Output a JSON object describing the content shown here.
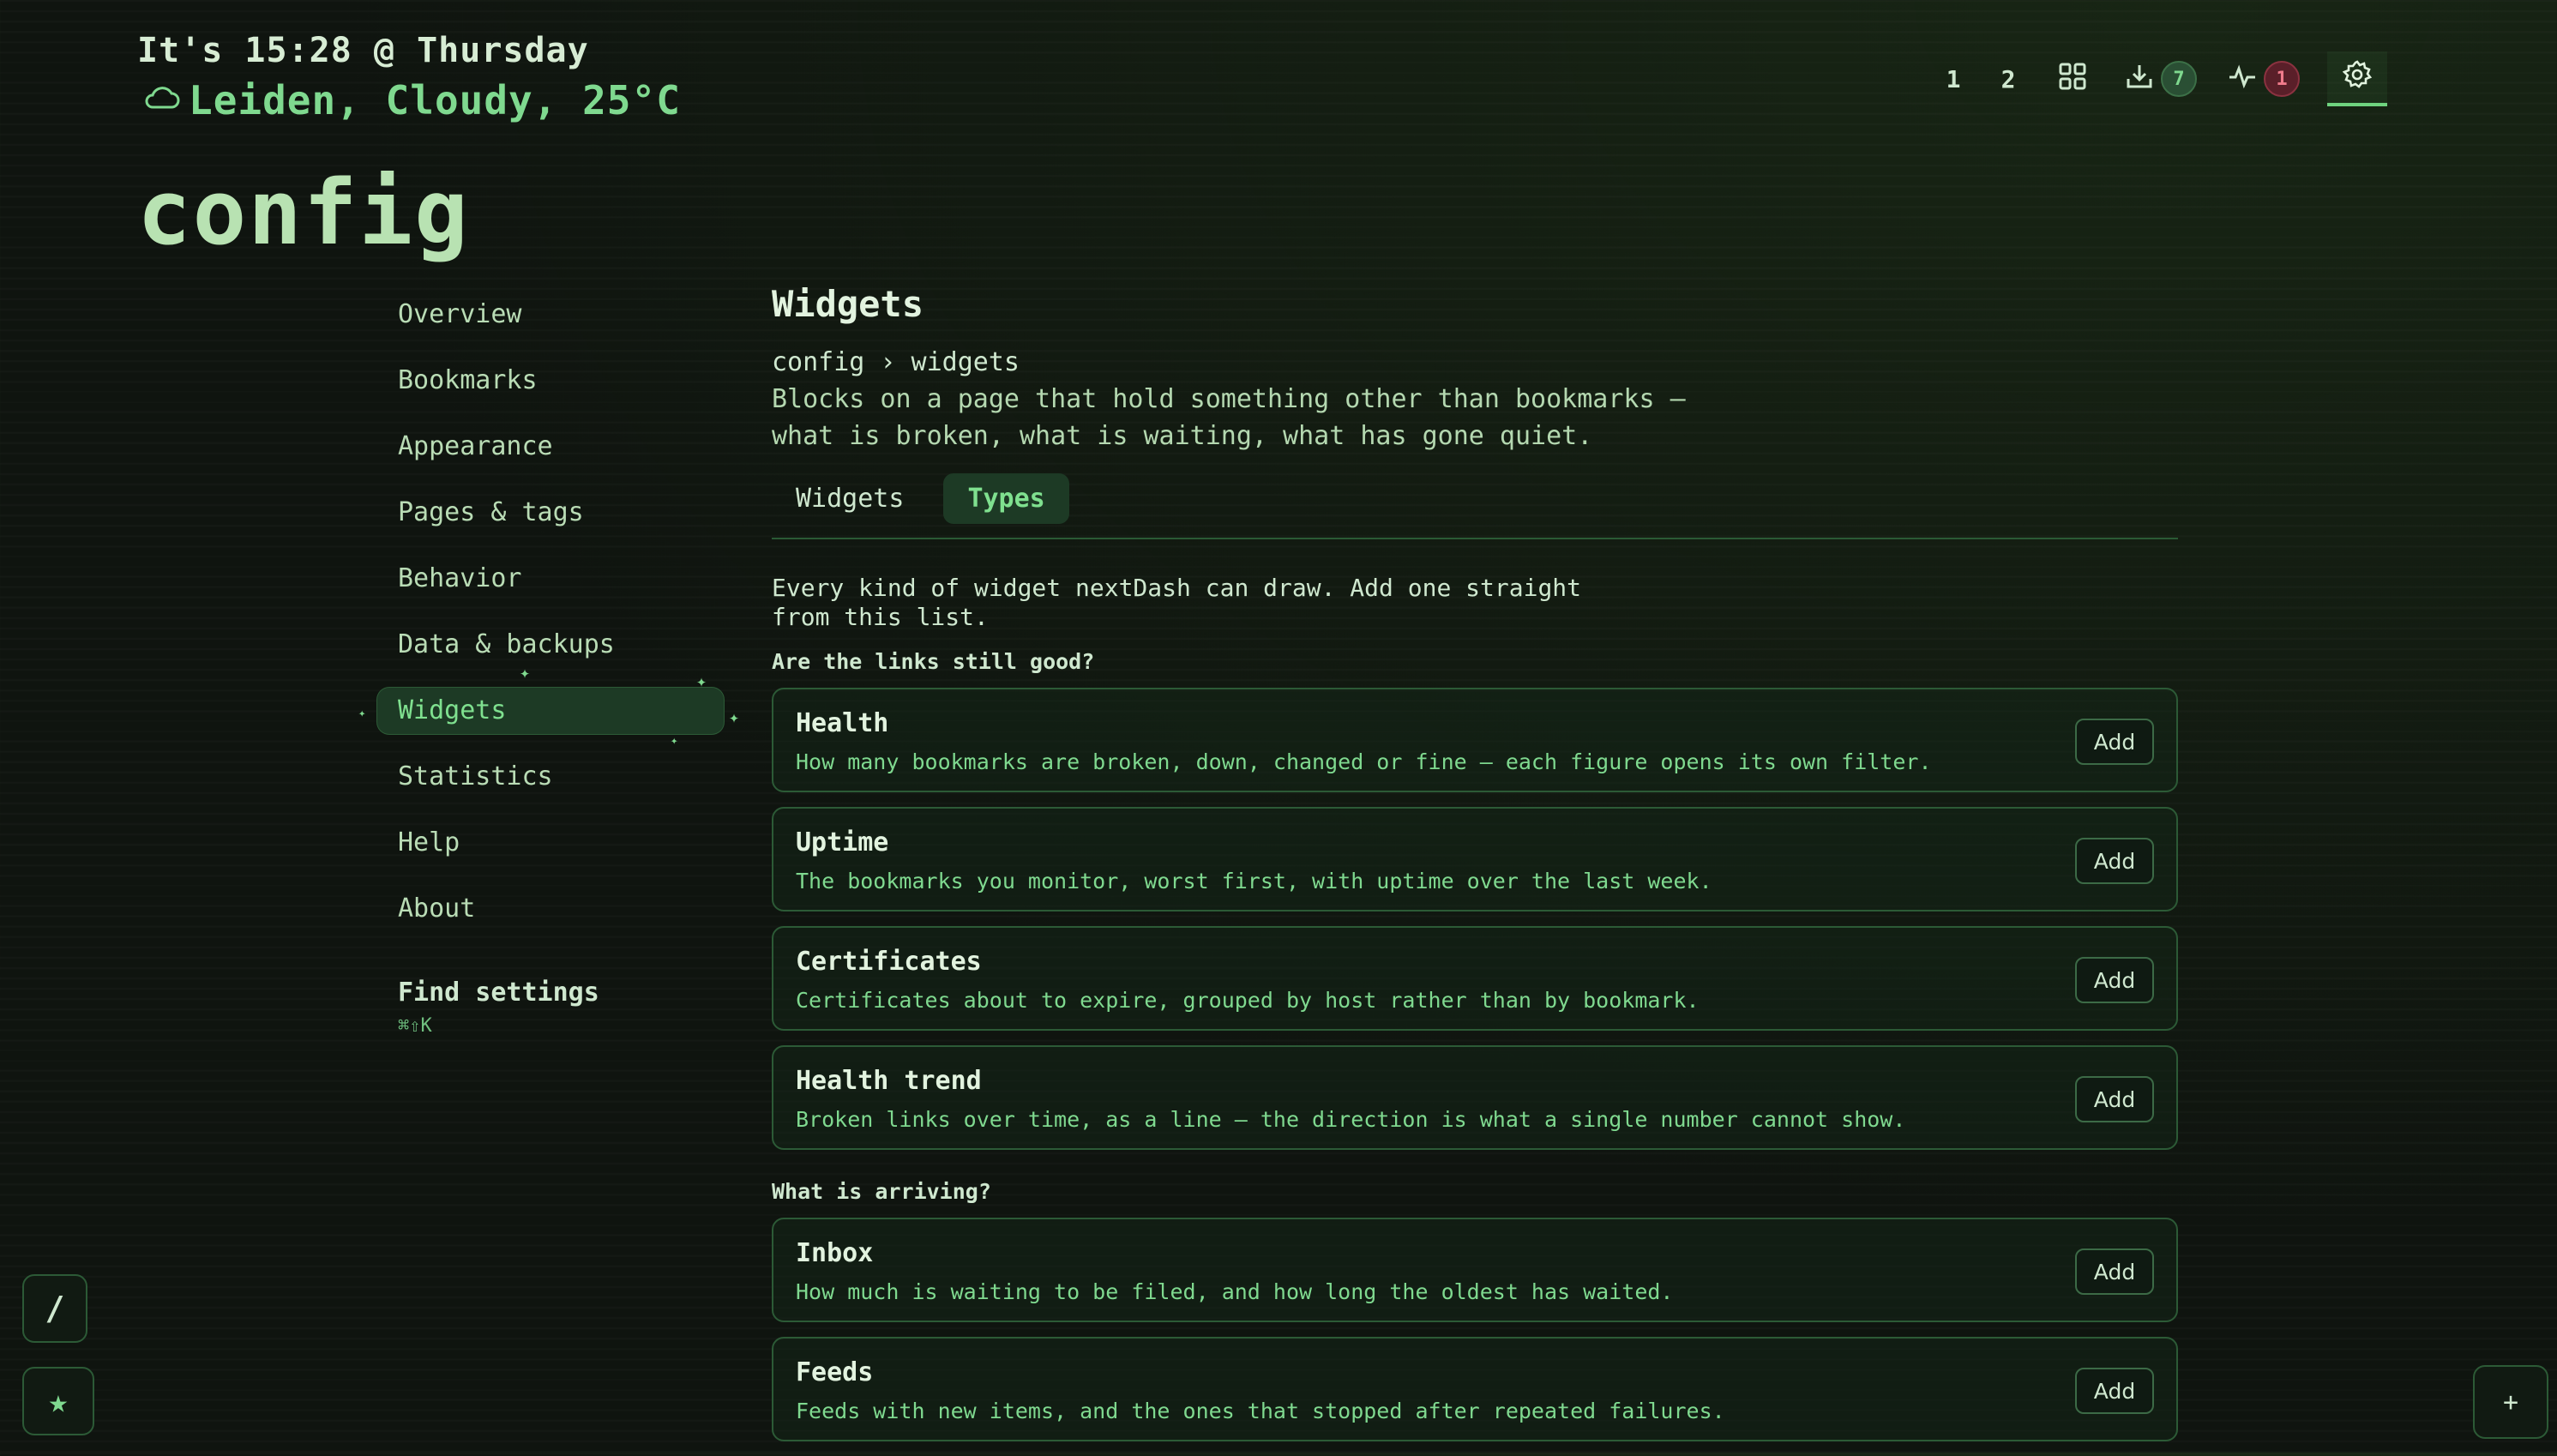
{
  "header": {
    "clock": "It's 15:28 @ Thursday",
    "weather": "Leiden, Cloudy, 25°C",
    "page_title": "config"
  },
  "topnav": {
    "page1": "1",
    "page2": "2",
    "downloads_count": "7",
    "alerts_count": "1",
    "icons": [
      "grid-icon",
      "download-tray-icon",
      "pulse-icon",
      "gear-icon"
    ]
  },
  "sidebar": {
    "items": [
      {
        "label": "Overview"
      },
      {
        "label": "Bookmarks"
      },
      {
        "label": "Appearance"
      },
      {
        "label": "Pages & tags"
      },
      {
        "label": "Behavior"
      },
      {
        "label": "Data & backups"
      },
      {
        "label": "Widgets",
        "active": true
      },
      {
        "label": "Statistics"
      },
      {
        "label": "Help"
      },
      {
        "label": "About"
      }
    ],
    "find_label": "Find settings",
    "find_shortcut": "⌘⇧K"
  },
  "main": {
    "title": "Widgets",
    "breadcrumb": "config › widgets",
    "description_line1": "Blocks on a page that hold something other than bookmarks —",
    "description_line2": "what is broken, what is waiting, what has gone quiet.",
    "tabs": [
      {
        "label": "Widgets"
      },
      {
        "label": "Types",
        "active": true
      }
    ],
    "intro_line1": "Every kind of widget nextDash can draw. Add one straight",
    "intro_line2": "from this list.",
    "groups": [
      {
        "heading": "Are the links still good?",
        "cards": [
          {
            "title": "Health",
            "desc": "How many bookmarks are broken, down, changed or fine — each figure opens its own filter.",
            "action": "Add"
          },
          {
            "title": "Uptime",
            "desc": "The bookmarks you monitor, worst first, with uptime over the last week.",
            "action": "Add"
          },
          {
            "title": "Certificates",
            "desc": "Certificates about to expire, grouped by host rather than by bookmark.",
            "action": "Add"
          },
          {
            "title": "Health trend",
            "desc": "Broken links over time, as a line — the direction is what a single number cannot show.",
            "action": "Add"
          }
        ]
      },
      {
        "heading": "What is arriving?",
        "cards": [
          {
            "title": "Inbox",
            "desc": "How much is waiting to be filed, and how long the oldest has waited.",
            "action": "Add"
          },
          {
            "title": "Feeds",
            "desc": "Feeds with new items, and the ones that stopped after repeated failures.",
            "action": "Add"
          }
        ]
      }
    ]
  },
  "floating": {
    "slash": "/",
    "plus": "+"
  },
  "colors": {
    "accent": "#7fd98f",
    "background": "#0f140f",
    "alert": "#f07b8b"
  }
}
